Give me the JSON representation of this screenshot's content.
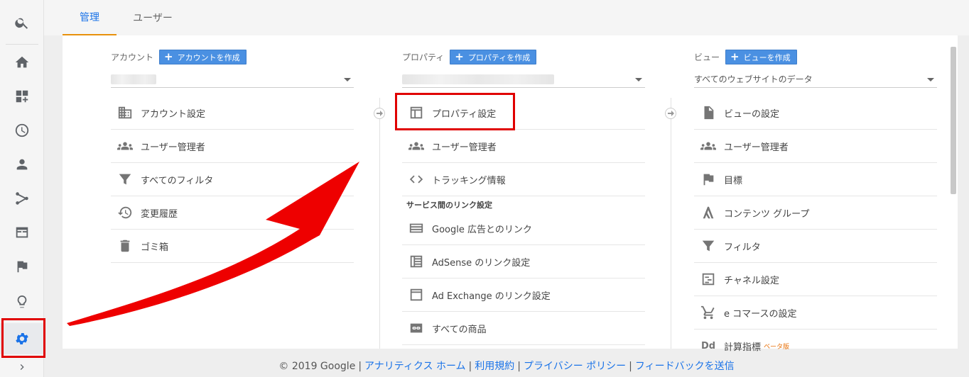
{
  "tabs": [
    {
      "label": "管理",
      "active": true
    },
    {
      "label": "ユーザー",
      "active": false
    }
  ],
  "rail_icons": [
    "search-icon",
    "home-icon",
    "dashboard-icon",
    "clock-icon",
    "person-icon",
    "acquisition-icon",
    "behavior-icon",
    "flag-icon",
    "lightbulb-icon",
    "gear-icon",
    "expand-icon"
  ],
  "account": {
    "label": "アカウント",
    "create": "アカウントを作成",
    "items": [
      "アカウント設定",
      "ユーザー管理者",
      "すべてのフィルタ",
      "変更履歴",
      "ゴミ箱"
    ]
  },
  "property": {
    "label": "プロパティ",
    "create": "プロパティを作成",
    "items": [
      "プロパティ設定",
      "ユーザー管理者",
      "トラッキング情報"
    ],
    "link_section": "サービス間のリンク設定",
    "link_items": [
      "Google 広告とのリンク",
      "AdSense のリンク設定",
      "Ad Exchange のリンク設定",
      "すべての商品"
    ]
  },
  "view": {
    "label": "ビュー",
    "create": "ビューを作成",
    "selected": "すべてのウェブサイトのデータ",
    "items": [
      "ビューの設定",
      "ユーザー管理者",
      "目標",
      "コンテンツ グループ",
      "フィルタ",
      "チャネル設定",
      "e コマースの設定",
      "計算指標"
    ],
    "beta": "ベータ版"
  },
  "footer": {
    "copyright": "© 2019 Google",
    "links": [
      "アナリティクス ホーム",
      "利用規約",
      "プライバシー ポリシー",
      "フィードバックを送信"
    ]
  },
  "colors": {
    "accent": "#1a73e8",
    "create_button": "#4a90e2",
    "highlight": "#e00000",
    "tab_underline": "#e8910c"
  }
}
